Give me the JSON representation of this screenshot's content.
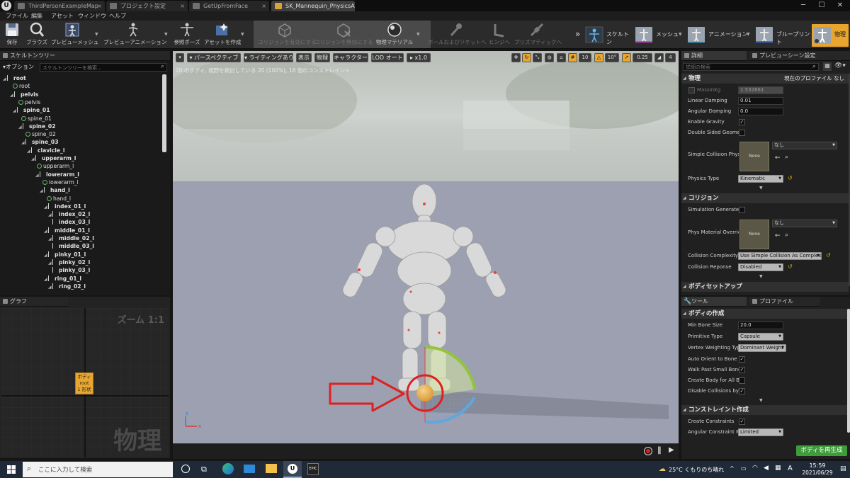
{
  "tabs": [
    {
      "label": "ThirdPersonExampleMap"
    },
    {
      "label": "プロジェクト設定"
    },
    {
      "label": "GetUpFromFace"
    },
    {
      "label": "SK_Mannequin_PhysicsAsset"
    }
  ],
  "window_buttons": {
    "minimize": "─",
    "maximize": "☐",
    "close": "✕"
  },
  "menu": [
    "ファイル",
    "編集",
    "アセット",
    "ウィンドウ",
    "ヘルプ"
  ],
  "toolbar": {
    "left": [
      {
        "label": "保存",
        "icon": "save-icon"
      },
      {
        "label": "ブラウズ",
        "icon": "browse-icon"
      },
      {
        "label": "プレビューメッシュ",
        "icon": "preview-mesh-icon"
      },
      {
        "label": "プレビューアニメーション",
        "icon": "preview-animation-icon"
      },
      {
        "label": "参照ポーズ",
        "icon": "reference-pose-icon"
      },
      {
        "label": "アセットを作成",
        "icon": "create-asset-icon"
      }
    ],
    "middle": [
      {
        "label": "コリジョンを有効にする",
        "icon": "enable-collision-icon"
      },
      {
        "label": "コリジョンを無効にする",
        "icon": "disable-collision-icon"
      },
      {
        "label": "物理マテリアル",
        "icon": "physics-material-icon"
      },
      {
        "label": "ボールおよびソケットへ",
        "icon": "ball-socket-icon"
      },
      {
        "label": "ヒンジへ",
        "icon": "hinge-icon"
      },
      {
        "label": "プリズマティックへ",
        "icon": "prismatic-icon"
      }
    ],
    "modes": [
      {
        "label": "スケルトン"
      },
      {
        "label": "メッシュ"
      },
      {
        "label": "アニメーション"
      },
      {
        "label": "ブループリント"
      },
      {
        "label": "物理"
      }
    ],
    "more": "»"
  },
  "skeleton_tree": {
    "title": "スケルトンツリー",
    "options_label": "オプション",
    "search_placeholder": "スケルトンツリーを検索...",
    "rows": [
      {
        "name": "root",
        "kind": "bone"
      },
      {
        "name": "root",
        "kind": "body"
      },
      {
        "name": "pelvis",
        "kind": "bone"
      },
      {
        "name": "pelvis",
        "kind": "body"
      },
      {
        "name": "spine_01",
        "kind": "bone"
      },
      {
        "name": "spine_01",
        "kind": "body"
      },
      {
        "name": "spine_02",
        "kind": "bone"
      },
      {
        "name": "spine_02",
        "kind": "body"
      },
      {
        "name": "spine_03",
        "kind": "bone"
      },
      {
        "name": "clavicle_l",
        "kind": "bone"
      },
      {
        "name": "upperarm_l",
        "kind": "bone"
      },
      {
        "name": "upperarm_l",
        "kind": "body"
      },
      {
        "name": "lowerarm_l",
        "kind": "bone"
      },
      {
        "name": "lowerarm_l",
        "kind": "body"
      },
      {
        "name": "hand_l",
        "kind": "bone"
      },
      {
        "name": "hand_l",
        "kind": "body"
      },
      {
        "name": "index_01_l",
        "kind": "bone"
      },
      {
        "name": "index_02_l",
        "kind": "bone"
      },
      {
        "name": "index_03_l",
        "kind": "bone"
      },
      {
        "name": "middle_01_l",
        "kind": "bone"
      },
      {
        "name": "middle_02_l",
        "kind": "bone"
      },
      {
        "name": "middle_03_l",
        "kind": "bone"
      },
      {
        "name": "pinky_01_l",
        "kind": "bone"
      },
      {
        "name": "pinky_02_l",
        "kind": "bone"
      },
      {
        "name": "pinky_03_l",
        "kind": "bone"
      },
      {
        "name": "ring_01_l",
        "kind": "bone"
      },
      {
        "name": "ring_02_l",
        "kind": "bone"
      }
    ]
  },
  "graph": {
    "title": "グラフ",
    "zoom": "ズーム 1:1",
    "watermark": "物理",
    "node": {
      "line1": "ボディ",
      "line2": "root",
      "line3": "1 形状"
    }
  },
  "viewport": {
    "buttons": {
      "perspective": "パースペクティブ",
      "lighting": "ライティングあり",
      "show": "表示",
      "physics": "物理",
      "character": "キャラクター",
      "lod": "LOD オート",
      "speed": "x1.0"
    },
    "snap": {
      "grid": "10",
      "rot": "10°",
      "scale": "0.25",
      "cam": "4"
    },
    "info": "20 のボディ, 視野を検討している 20 (100%), 18 個のコンストレイント",
    "axis": {
      "x": "x",
      "z": "z"
    }
  },
  "details": {
    "tab_details": "詳細",
    "tab_preview": "プレビューシーン設定",
    "search_placeholder": "詳細の検索",
    "physics": {
      "header": "物理",
      "profile_label": "現在のプロファイル",
      "profile_value": "なし",
      "mass_label": "MassInKg",
      "mass_value": "1.532661",
      "linear_damping_label": "Linear Damping",
      "linear_damping": "0.01",
      "angular_damping_label": "Angular Damping",
      "angular_damping": "0.0",
      "enable_gravity_label": "Enable Gravity",
      "double_sided_label": "Double Sided Geometry",
      "simple_collision_label": "Simple Collision Phys",
      "simple_collision_value": "なし",
      "thumb_none": "None",
      "physics_type_label": "Physics Type",
      "physics_type": "Kinematic"
    },
    "collision": {
      "header": "コリジョン",
      "sim_generates_label": "Simulation Generates",
      "phys_material_label": "Phys Material Overrid",
      "phys_material_value": "なし",
      "complexity_label": "Collision Complexity",
      "complexity": "Use Simple Collision As Complex",
      "response_label": "Collision Reponse",
      "response": "Disabled"
    },
    "body_setup_header": "ボディセットアップ"
  },
  "tools": {
    "tab_tools": "ツール",
    "tab_profile": "プロファイル",
    "body_creation": {
      "header": "ボディの作成",
      "min_bone_size_label": "Min Bone Size",
      "min_bone_size": "20.0",
      "primitive_type_label": "Primitive Type",
      "primitive_type": "Capsule",
      "vertex_weighting_label": "Vertex Weighting Type",
      "vertex_weighting": "Dominant Weight",
      "auto_orient_label": "Auto Orient to Bone",
      "walk_past_label": "Walk Past Small Bone",
      "create_all_label": "Create Body for All Bo",
      "disable_collisions_label": "Disable Collisions by I"
    },
    "constraint_creation": {
      "header": "コンストレイント作成",
      "create_constraints_label": "Create Constraints",
      "angular_mode_label": "Angular Constraint Mo",
      "angular_mode": "Limited"
    },
    "regenerate_button": "ボディを再生成"
  },
  "taskbar": {
    "search_placeholder": "ここに入力して検索",
    "weather": "25°C くもりのち晴れ",
    "ime": "A",
    "time": "15:59",
    "date": "2021/06/29"
  },
  "colors": {
    "accent_orange": "#e8a62e",
    "regen_green": "#3e9d3a",
    "annotation_red": "#e02020"
  }
}
